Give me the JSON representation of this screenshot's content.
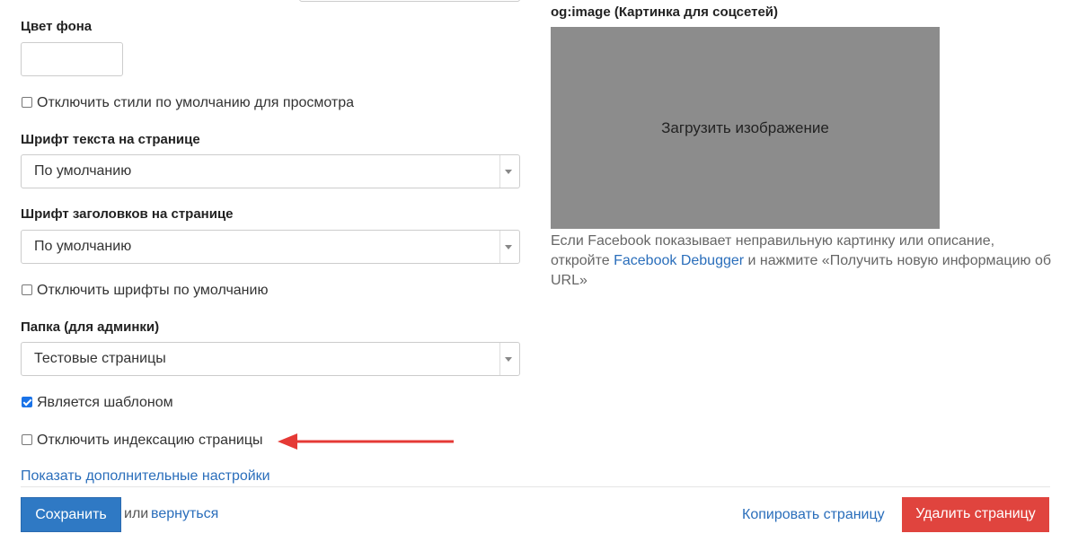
{
  "bg_color": {
    "label": "Цвет фона",
    "value": ""
  },
  "disable_default_styles": {
    "label": "Отключить стили по умолчанию для просмотра",
    "checked": false
  },
  "text_font": {
    "label": "Шрифт текста на странице",
    "value": "По умолчанию"
  },
  "heading_font": {
    "label": "Шрифт заголовков на странице",
    "value": "По умолчанию"
  },
  "disable_default_fonts": {
    "label": "Отключить шрифты по умолчанию",
    "checked": false
  },
  "folder": {
    "label": "Папка (для админки)",
    "value": "Тестовые страницы"
  },
  "is_template": {
    "label": "Является шаблоном",
    "checked": true
  },
  "disable_indexing": {
    "label": "Отключить индексацию страницы",
    "checked": false
  },
  "more_settings_link": "Показать дополнительные настройки",
  "og_image": {
    "label": "og:image (Картинка для соцсетей)",
    "upload_text": "Загрузить изображение",
    "help_before": "Если Facebook показывает неправильную картинку или описание, откройте ",
    "help_link": "Facebook Debugger",
    "help_after": " и нажмите «Получить новую информацию об URL»"
  },
  "footer": {
    "save_label": "Сохранить",
    "or_text": "или",
    "back_link": "вернуться",
    "copy_link": "Копировать страницу",
    "delete_label": "Удалить страницу"
  },
  "colors": {
    "primary": "#2f79c4",
    "danger": "#e0443e",
    "link": "#2a6ebb",
    "arrow": "#e53935",
    "upload_bg": "#8c8c8c"
  }
}
